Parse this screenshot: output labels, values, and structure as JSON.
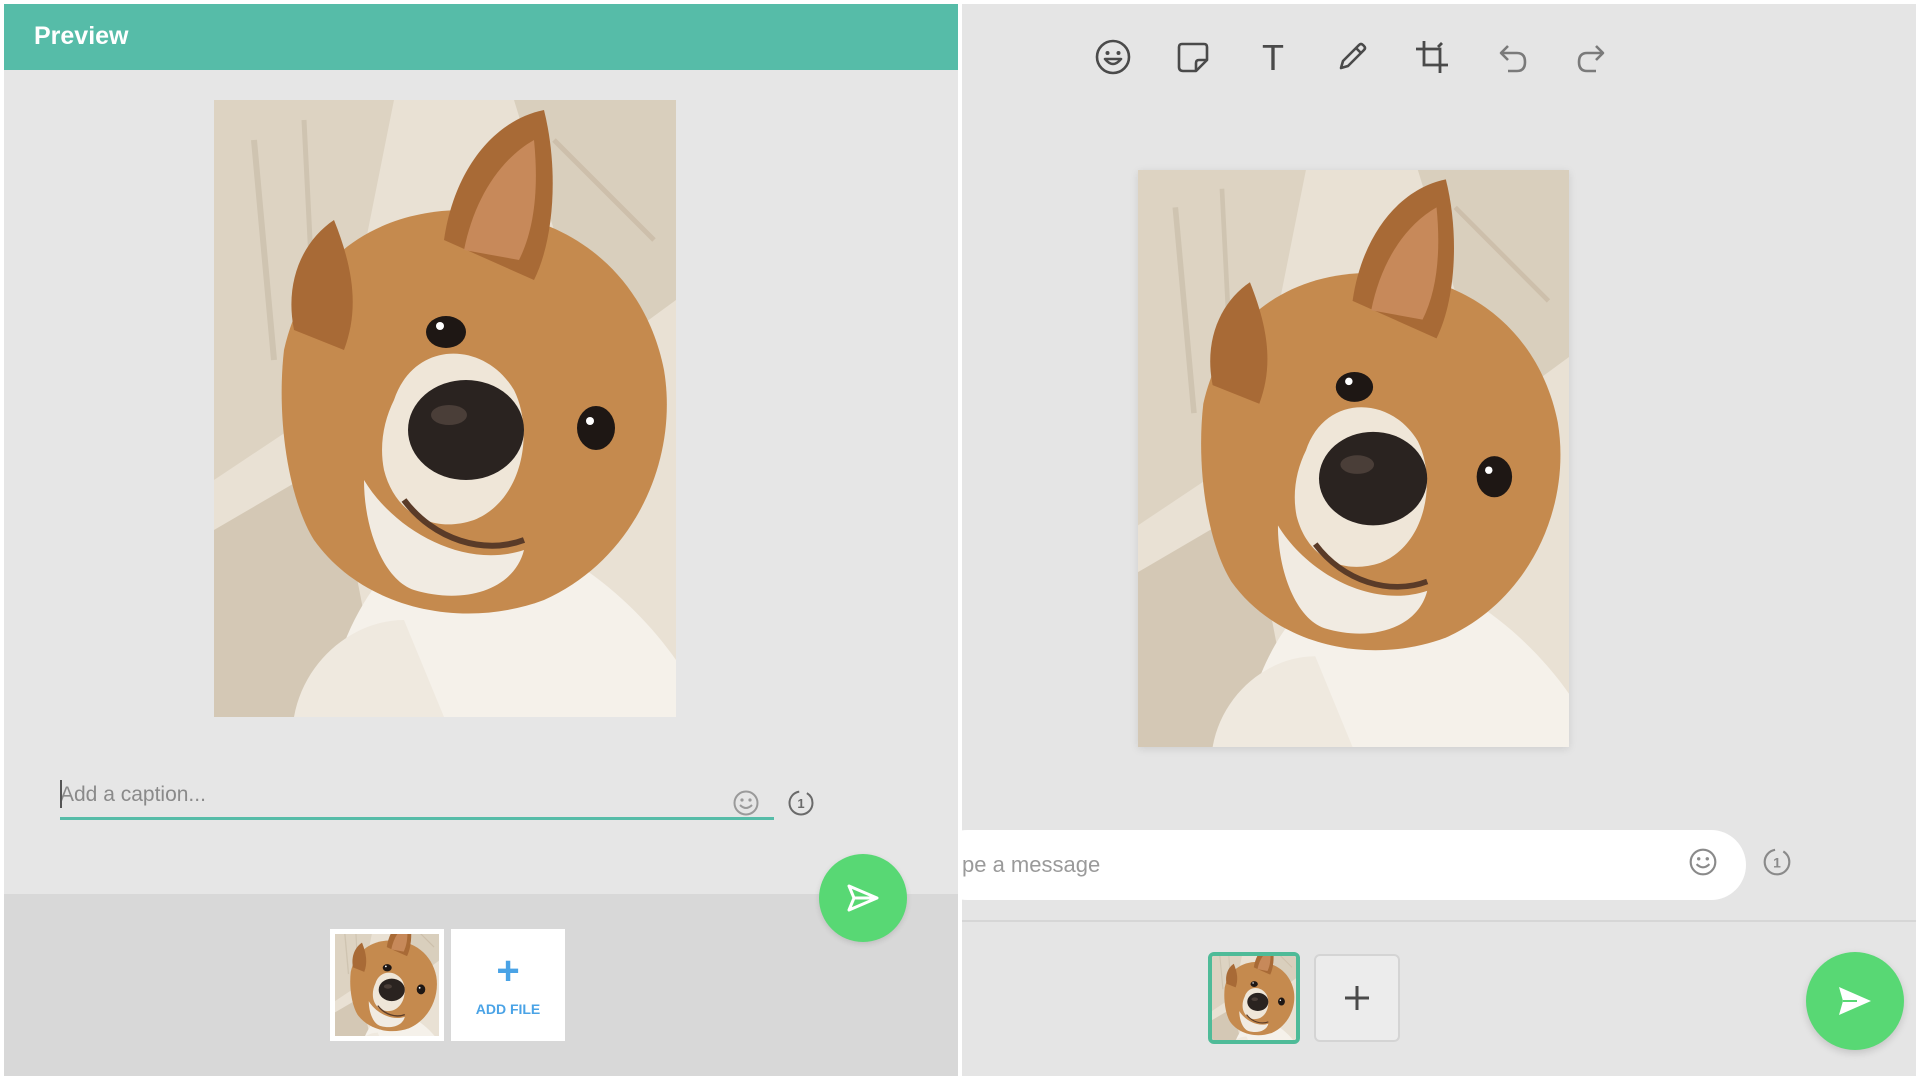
{
  "left_panel": {
    "title": "Preview",
    "caption": {
      "placeholder": "Add a caption...",
      "value": ""
    },
    "icons": {
      "emoji": "emoji-icon",
      "view_once": "view-once-icon",
      "view_once_label": "1",
      "send": "send-icon"
    },
    "add_file_label": "ADD FILE",
    "photo_alt": "dog photo"
  },
  "right_panel": {
    "toolbar": [
      "emoji-icon",
      "sticker-icon",
      "text-icon",
      "pencil-icon",
      "crop-icon",
      "undo-icon",
      "redo-icon"
    ],
    "text_tool_label": "T",
    "message": {
      "placeholder": "pe a message",
      "value": ""
    },
    "icons": {
      "view_once_label": "1"
    }
  },
  "colors": {
    "accent": "#56bca8",
    "send_green": "#58d874",
    "link_blue": "#4aa3e6",
    "panel_bg": "#e6e6e6"
  }
}
